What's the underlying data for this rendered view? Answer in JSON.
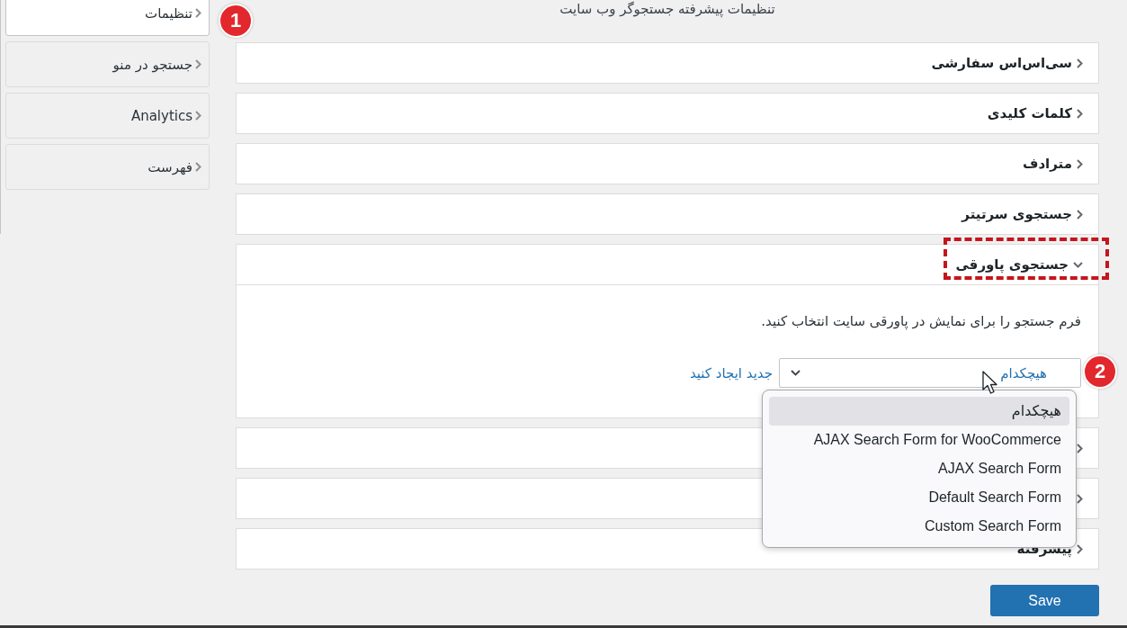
{
  "page_title": "تنظیمات پیشرفته جستجوگر وب سایت",
  "sidebar": {
    "tabs": [
      {
        "label": "تنظیمات",
        "selected": true,
        "badge": "1"
      },
      {
        "label": "جستجو در منو",
        "selected": false
      },
      {
        "label": "Analytics",
        "selected": false
      },
      {
        "label": "فهرست",
        "selected": false
      }
    ]
  },
  "sections": [
    {
      "title": "سی‌اس‌اس سفارشی",
      "expanded": false,
      "highlighted": false
    },
    {
      "title": "کلمات کلیدی",
      "expanded": false,
      "highlighted": false
    },
    {
      "title": "مترادف",
      "expanded": false,
      "highlighted": false
    },
    {
      "title": "جستجوی سرتیتر",
      "expanded": false,
      "highlighted": false
    },
    {
      "title": "جستجوی پاورقی",
      "expanded": true,
      "highlighted": true,
      "body": {
        "description": "فرم جستجو را برای نمایش در پاورقی سایت انتخاب کنید.",
        "select": {
          "value": "هیچکدام",
          "badge": "2",
          "open": true,
          "options": [
            {
              "label": "هیچکدام",
              "selected": true
            },
            {
              "label": "AJAX Search Form for WooCommerce",
              "selected": false
            },
            {
              "label": "AJAX Search Form",
              "selected": false
            },
            {
              "label": "Default Search Form",
              "selected": false
            },
            {
              "label": "Custom Search Form",
              "selected": false
            }
          ]
        },
        "link": "جدید ایجاد کنید"
      }
    },
    {
      "expanded": false,
      "highlighted": false
    },
    {
      "expanded": false,
      "highlighted": false
    },
    {
      "title": "پیشرفته",
      "expanded": false,
      "highlighted": false
    }
  ],
  "save_button": "Save"
}
